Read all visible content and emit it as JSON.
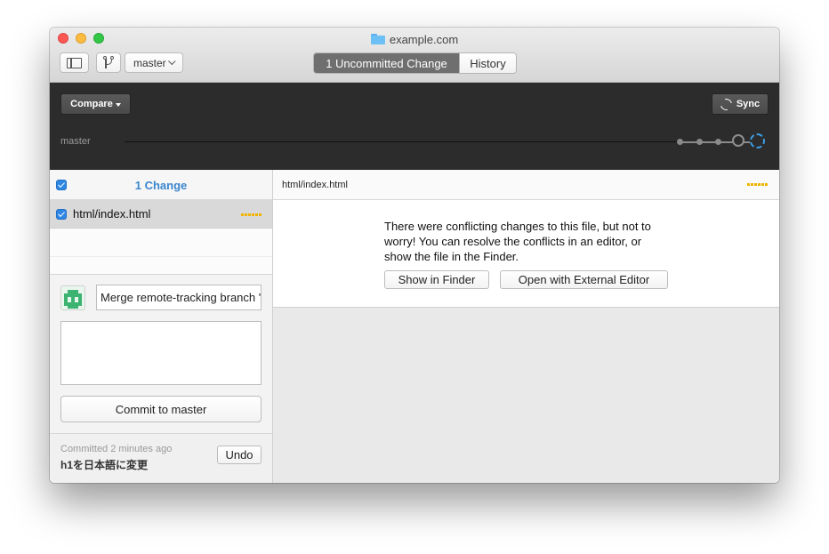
{
  "window": {
    "title": "example.com"
  },
  "toolbar": {
    "branch_select": "master",
    "segments": [
      {
        "label": "1 Uncommitted Change",
        "active": true
      },
      {
        "label": "History",
        "active": false
      }
    ]
  },
  "sync_bar": {
    "compare_label": "Compare",
    "sync_label": "Sync",
    "branch_label": "master"
  },
  "changes": {
    "header": "1 Change",
    "files": [
      {
        "path": "html/index.html",
        "checked": true,
        "status": "conflict"
      }
    ]
  },
  "commit": {
    "summary_value": "Merge remote-tracking branch '",
    "description_value": "",
    "commit_button": "Commit to master"
  },
  "last_commit": {
    "meta": "Committed 2 minutes ago",
    "message": "h1を日本語に変更",
    "undo_label": "Undo"
  },
  "diff": {
    "file_path": "html/index.html",
    "message": "There were conflicting changes to this file, but not to worry! You can resolve the conflicts in an editor, or show the file in the Finder.",
    "show_in_finder": "Show in Finder",
    "open_external_editor": "Open with External Editor"
  },
  "colors": {
    "accent_blue": "#3b86cf",
    "conflict_yellow": "#f0b400",
    "dark_bar": "#2c2c2c",
    "avatar_green": "#3cb371"
  }
}
